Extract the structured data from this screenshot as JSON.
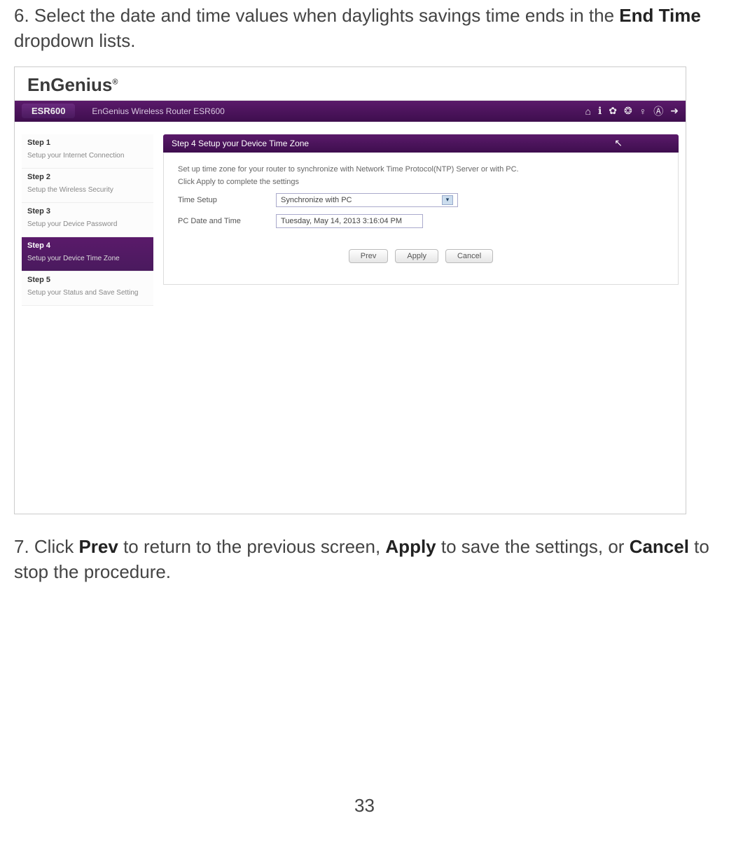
{
  "doc": {
    "step6_pre": "6. Select the date and time values when daylights savings time ends in the ",
    "step6_bold": "End Time",
    "step6_post": " dropdown lists.",
    "step7_a": "7. Click ",
    "step7_prev": "Prev",
    "step7_b": " to return to the previous screen, ",
    "step7_apply": "Apply",
    "step7_c": " to save the settings, or ",
    "step7_cancel": "Cancel",
    "step7_d": " to stop the procedure.",
    "page_number": "33"
  },
  "router": {
    "brand": "EnGenius",
    "brand_sup": "®",
    "model": "ESR600",
    "title": "EnGenius Wireless Router ESR600",
    "icons": [
      "home",
      "info",
      "gear",
      "globe",
      "help",
      "refresh",
      "logout"
    ],
    "sidebar": [
      {
        "num": "Step 1",
        "desc": "Setup your Internet Connection"
      },
      {
        "num": "Step 2",
        "desc": "Setup the Wireless Security"
      },
      {
        "num": "Step 3",
        "desc": "Setup your Device Password"
      },
      {
        "num": "Step 4",
        "desc": "Setup your Device Time Zone"
      },
      {
        "num": "Step 5",
        "desc": "Setup your Status and Save Setting"
      }
    ],
    "panel": {
      "header": "Step 4  Setup your Device Time Zone",
      "line1": "Set up time zone for your router to synchronize with Network Time Protocol(NTP) Server or with PC.",
      "line2": "Click Apply to complete the settings",
      "row1_label": "Time Setup",
      "row1_value": "Synchronize with PC",
      "row2_label": "PC Date and Time",
      "row2_value": "Tuesday, May 14, 2013 3:16:04 PM",
      "buttons": {
        "prev": "Prev",
        "apply": "Apply",
        "cancel": "Cancel"
      }
    }
  }
}
